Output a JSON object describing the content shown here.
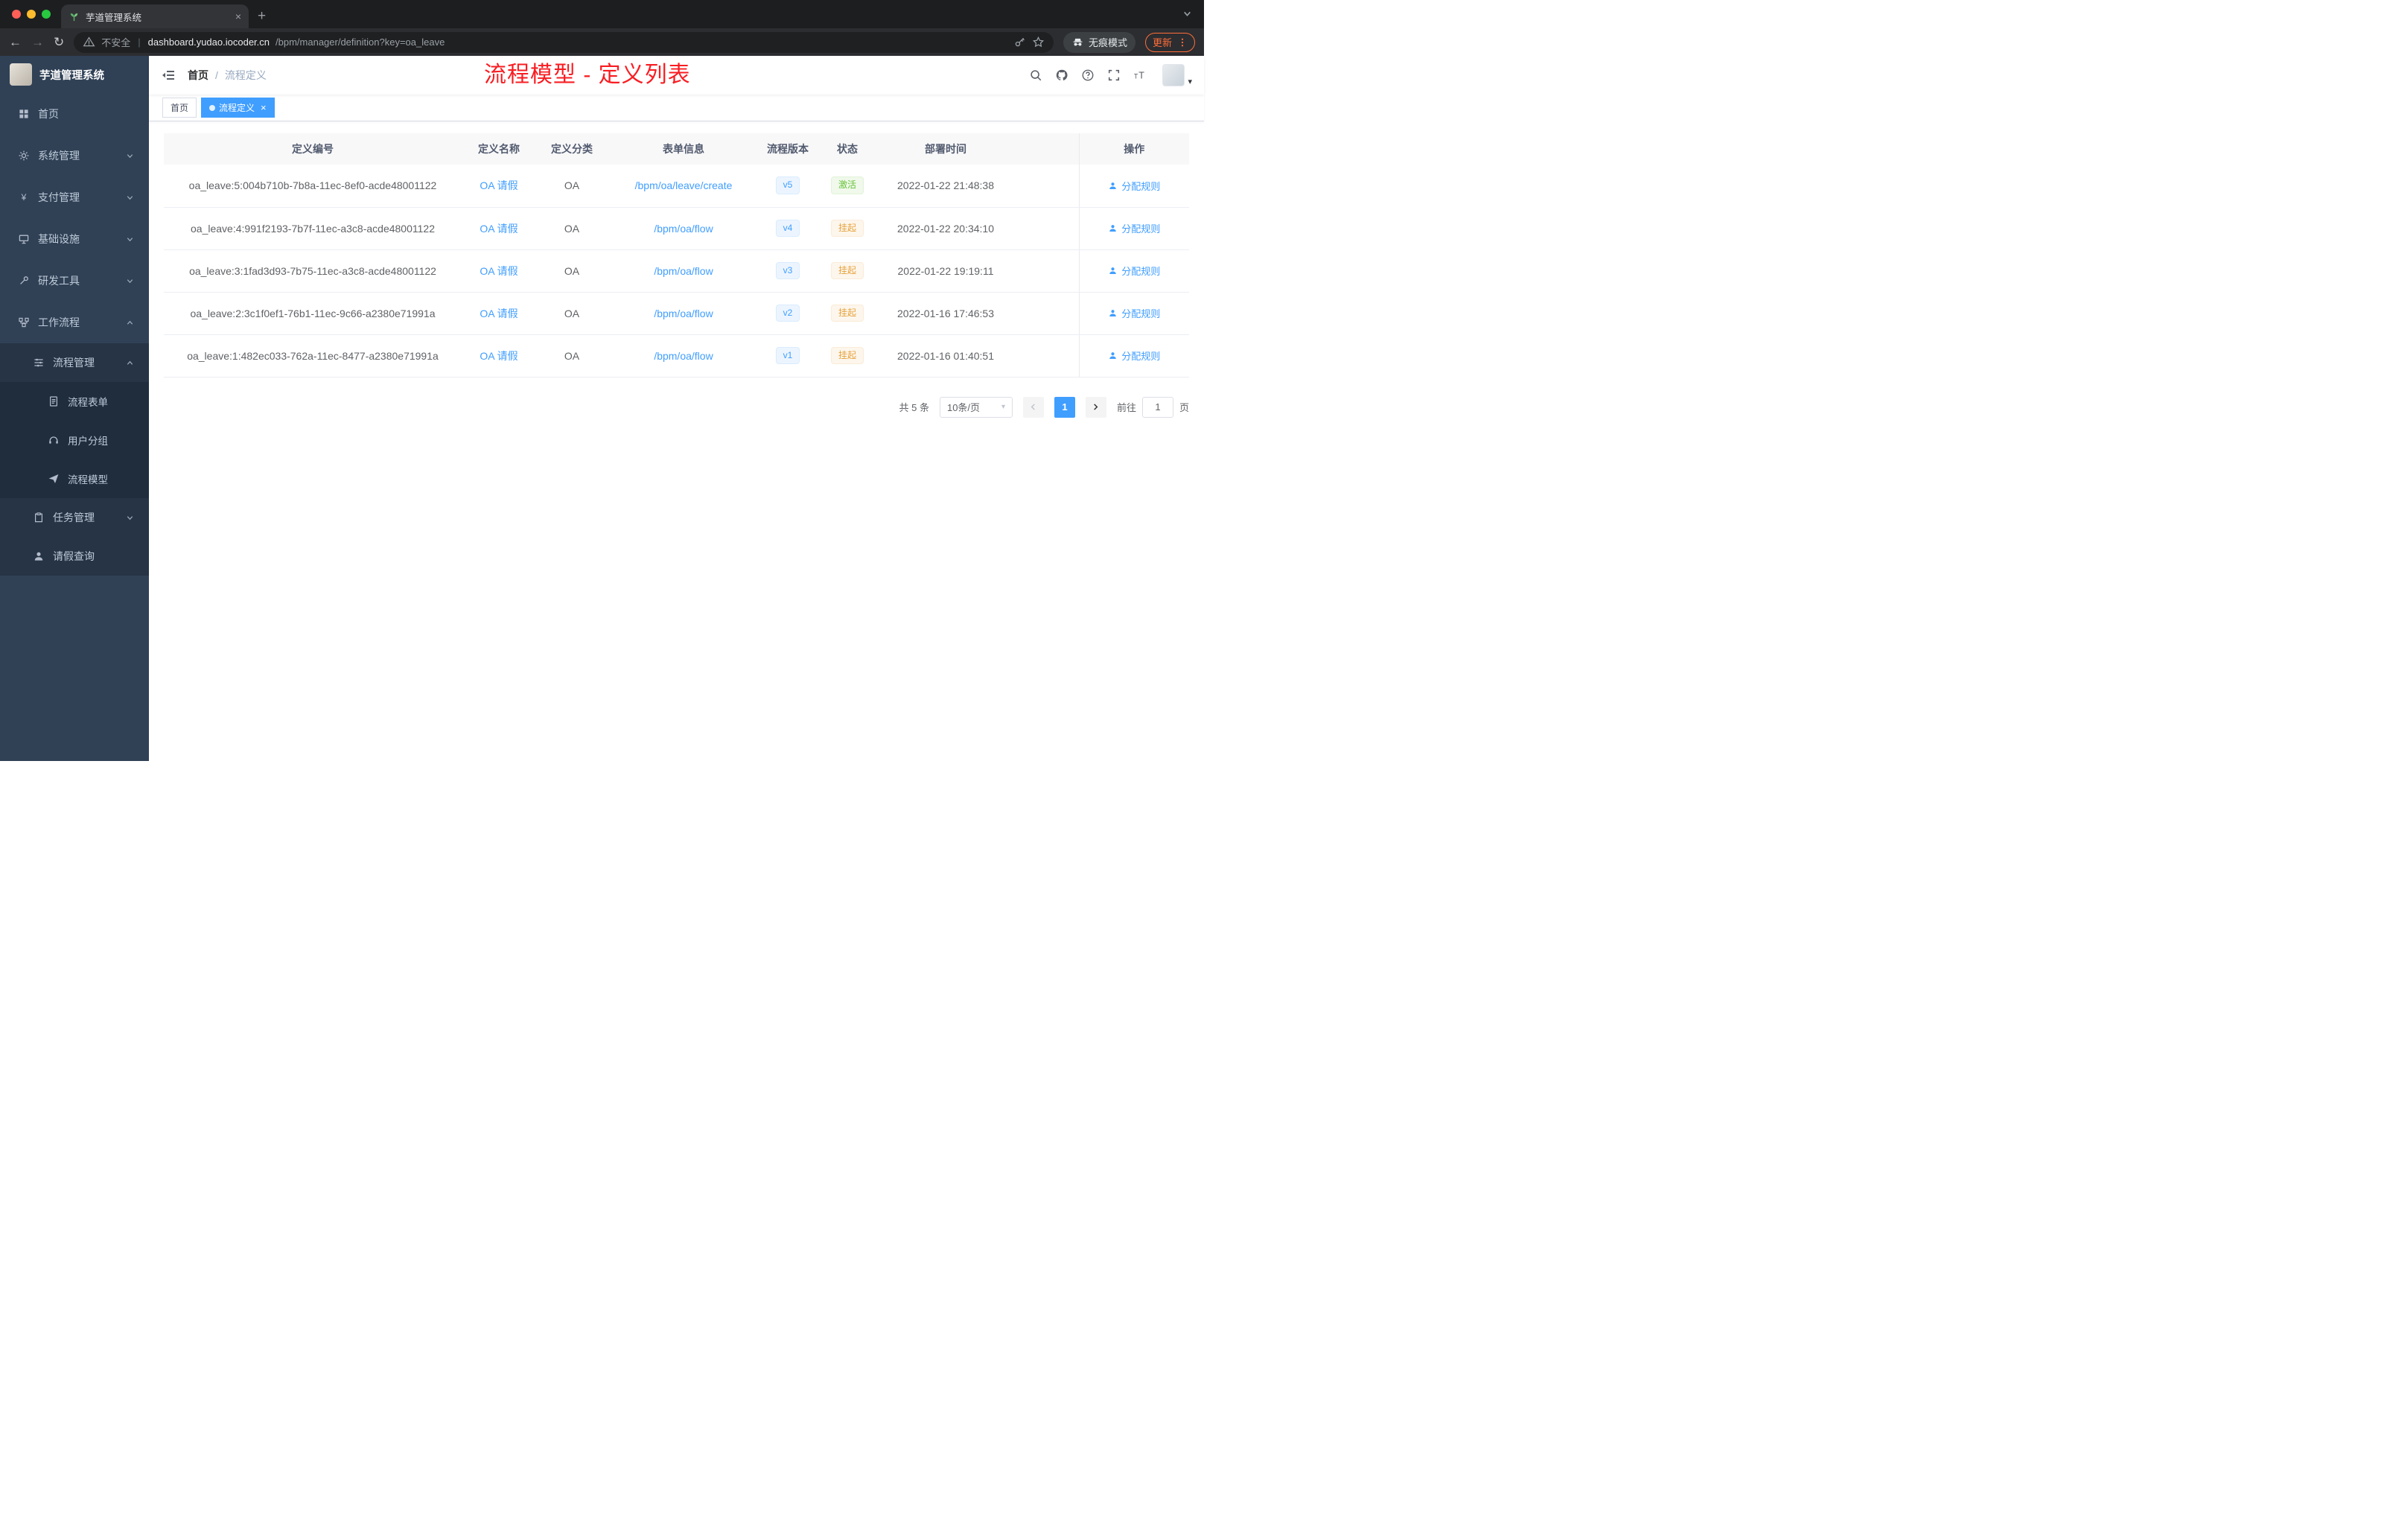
{
  "browser": {
    "tab_title": "芋道管理系统",
    "security_label": "不安全",
    "url_host": "dashboard.yudao.iocoder.cn",
    "url_path": "/bpm/manager/definition?key=oa_leave",
    "profile_label": "无痕模式",
    "update_label": "更新",
    "icons": [
      "back-icon",
      "forward-icon",
      "reload-icon",
      "warning-icon",
      "key-icon",
      "star-icon",
      "incognito-icon",
      "menu-dots-icon",
      "new-tab-icon",
      "tab-close-icon",
      "tabstrip-chevron-icon",
      "favicon"
    ]
  },
  "sidebar": {
    "logo_title": "芋道管理系统",
    "items": [
      {
        "label": "首页",
        "icon": "dashboard-icon",
        "level": 0
      },
      {
        "label": "系统管理",
        "icon": "gear-icon",
        "level": 0,
        "expanded": false
      },
      {
        "label": "支付管理",
        "icon": "payment-icon",
        "level": 0,
        "expanded": false
      },
      {
        "label": "基础设施",
        "icon": "infrastructure-icon",
        "level": 0,
        "expanded": false
      },
      {
        "label": "研发工具",
        "icon": "devtools-icon",
        "level": 0,
        "expanded": false
      },
      {
        "label": "工作流程",
        "icon": "workflow-icon",
        "level": 0,
        "expanded": true
      },
      {
        "label": "流程管理",
        "icon": "process-manage-icon",
        "level": 1,
        "expanded": true
      },
      {
        "label": "流程表单",
        "icon": "process-form-icon",
        "level": 2
      },
      {
        "label": "用户分组",
        "icon": "user-group-icon",
        "level": 2
      },
      {
        "label": "流程模型",
        "icon": "process-model-icon",
        "level": 2
      },
      {
        "label": "任务管理",
        "icon": "task-manage-icon",
        "level": 1,
        "expanded": false
      },
      {
        "label": "请假查询",
        "icon": "leave-query-icon",
        "level": 1
      }
    ]
  },
  "header": {
    "breadcrumb": [
      "首页",
      "流程定义"
    ],
    "breadcrumb_separator": "/",
    "annotation": "流程模型 - 定义列表",
    "icons": [
      "search-icon",
      "github-icon",
      "question-icon",
      "fullscreen-icon",
      "font-size-icon",
      "avatar",
      "caret-down-icon",
      "fold-icon"
    ]
  },
  "tags": [
    {
      "label": "首页",
      "active": false
    },
    {
      "label": "流程定义",
      "active": true
    }
  ],
  "table": {
    "columns": [
      "定义编号",
      "定义名称",
      "定义分类",
      "表单信息",
      "流程版本",
      "状态",
      "部署时间",
      "操作"
    ],
    "rows": [
      {
        "id": "oa_leave:5:004b710b-7b8a-11ec-8ef0-acde48001122",
        "name": "OA 请假",
        "category": "OA",
        "form": "/bpm/oa/leave/create",
        "version": "v5",
        "status": "激活",
        "status_type": "success",
        "deploy_time": "2022-01-22 21:48:38",
        "action": "分配规则"
      },
      {
        "id": "oa_leave:4:991f2193-7b7f-11ec-a3c8-acde48001122",
        "name": "OA 请假",
        "category": "OA",
        "form": "/bpm/oa/flow",
        "version": "v4",
        "status": "挂起",
        "status_type": "warning",
        "deploy_time": "2022-01-22 20:34:10",
        "action": "分配规则"
      },
      {
        "id": "oa_leave:3:1fad3d93-7b75-11ec-a3c8-acde48001122",
        "name": "OA 请假",
        "category": "OA",
        "form": "/bpm/oa/flow",
        "version": "v3",
        "status": "挂起",
        "status_type": "warning",
        "deploy_time": "2022-01-22 19:19:11",
        "action": "分配规则"
      },
      {
        "id": "oa_leave:2:3c1f0ef1-76b1-11ec-9c66-a2380e71991a",
        "name": "OA 请假",
        "category": "OA",
        "form": "/bpm/oa/flow",
        "version": "v2",
        "status": "挂起",
        "status_type": "warning",
        "deploy_time": "2022-01-16 17:46:53",
        "action": "分配规则"
      },
      {
        "id": "oa_leave:1:482ec033-762a-11ec-8477-a2380e71991a",
        "name": "OA 请假",
        "category": "OA",
        "form": "/bpm/oa/flow",
        "version": "v1",
        "status": "挂起",
        "status_type": "warning",
        "deploy_time": "2022-01-16 01:40:51",
        "action": "分配规则"
      }
    ]
  },
  "pagination": {
    "total": "共 5 条",
    "page_size": "10条/页",
    "current_page": "1",
    "goto_label": "前往",
    "goto_value": "1",
    "page_unit": "页"
  },
  "colors": {
    "accent": "#409eff",
    "sidebar_bg": "#304156",
    "submenu_bg": "#1f2d3d",
    "success": "#67c23a",
    "warning": "#e6a23c",
    "annotation_red": "#f81d22"
  }
}
